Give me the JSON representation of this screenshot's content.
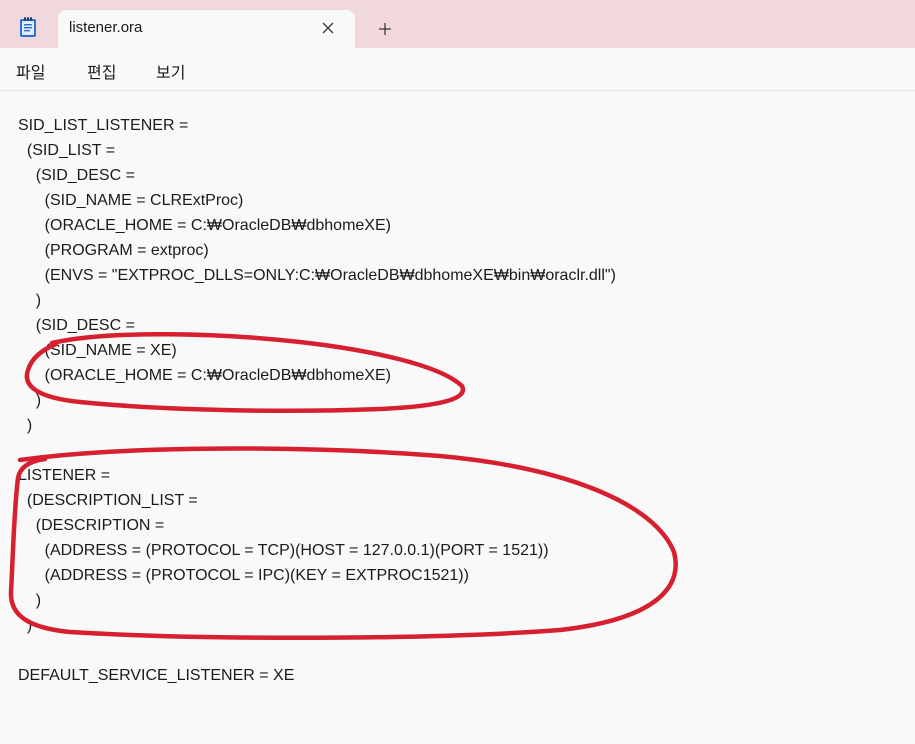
{
  "window": {
    "tab_title": "listener.ora",
    "new_tab_symbol": "+",
    "icons": [
      "notepad-icon",
      "close-icon",
      "plus-icon"
    ]
  },
  "menu": [
    {
      "label": "파일"
    },
    {
      "label": "편집"
    },
    {
      "label": "보기"
    }
  ],
  "editor": {
    "lines": [
      "SID_LIST_LISTENER =",
      "  (SID_LIST =",
      "    (SID_DESC =",
      "      (SID_NAME = CLRExtProc)",
      "      (ORACLE_HOME = C:₩OracleDB₩dbhomeXE)",
      "      (PROGRAM = extproc)",
      "      (ENVS = \"EXTPROC_DLLS=ONLY:C:₩OracleDB₩dbhomeXE₩bin₩oraclr.dll\")",
      "    )",
      "    (SID_DESC =",
      "      (SID_NAME = XE)",
      "      (ORACLE_HOME = C:₩OracleDB₩dbhomeXE)",
      "    )",
      "  )",
      "",
      "LISTENER =",
      "  (DESCRIPTION_LIST =",
      "    (DESCRIPTION =",
      "      (ADDRESS = (PROTOCOL = TCP)(HOST = 127.0.0.1)(PORT = 1521))",
      "      (ADDRESS = (PROTOCOL = IPC)(KEY = EXTPROC1521))",
      "    )",
      "  )",
      "",
      "DEFAULT_SERVICE_LISTENER = XE"
    ]
  },
  "colors": {
    "tab_strip": "#f1d8da",
    "background": "#f9f9f9",
    "text": "#1b1b1b",
    "annotation": "#d7202f"
  }
}
